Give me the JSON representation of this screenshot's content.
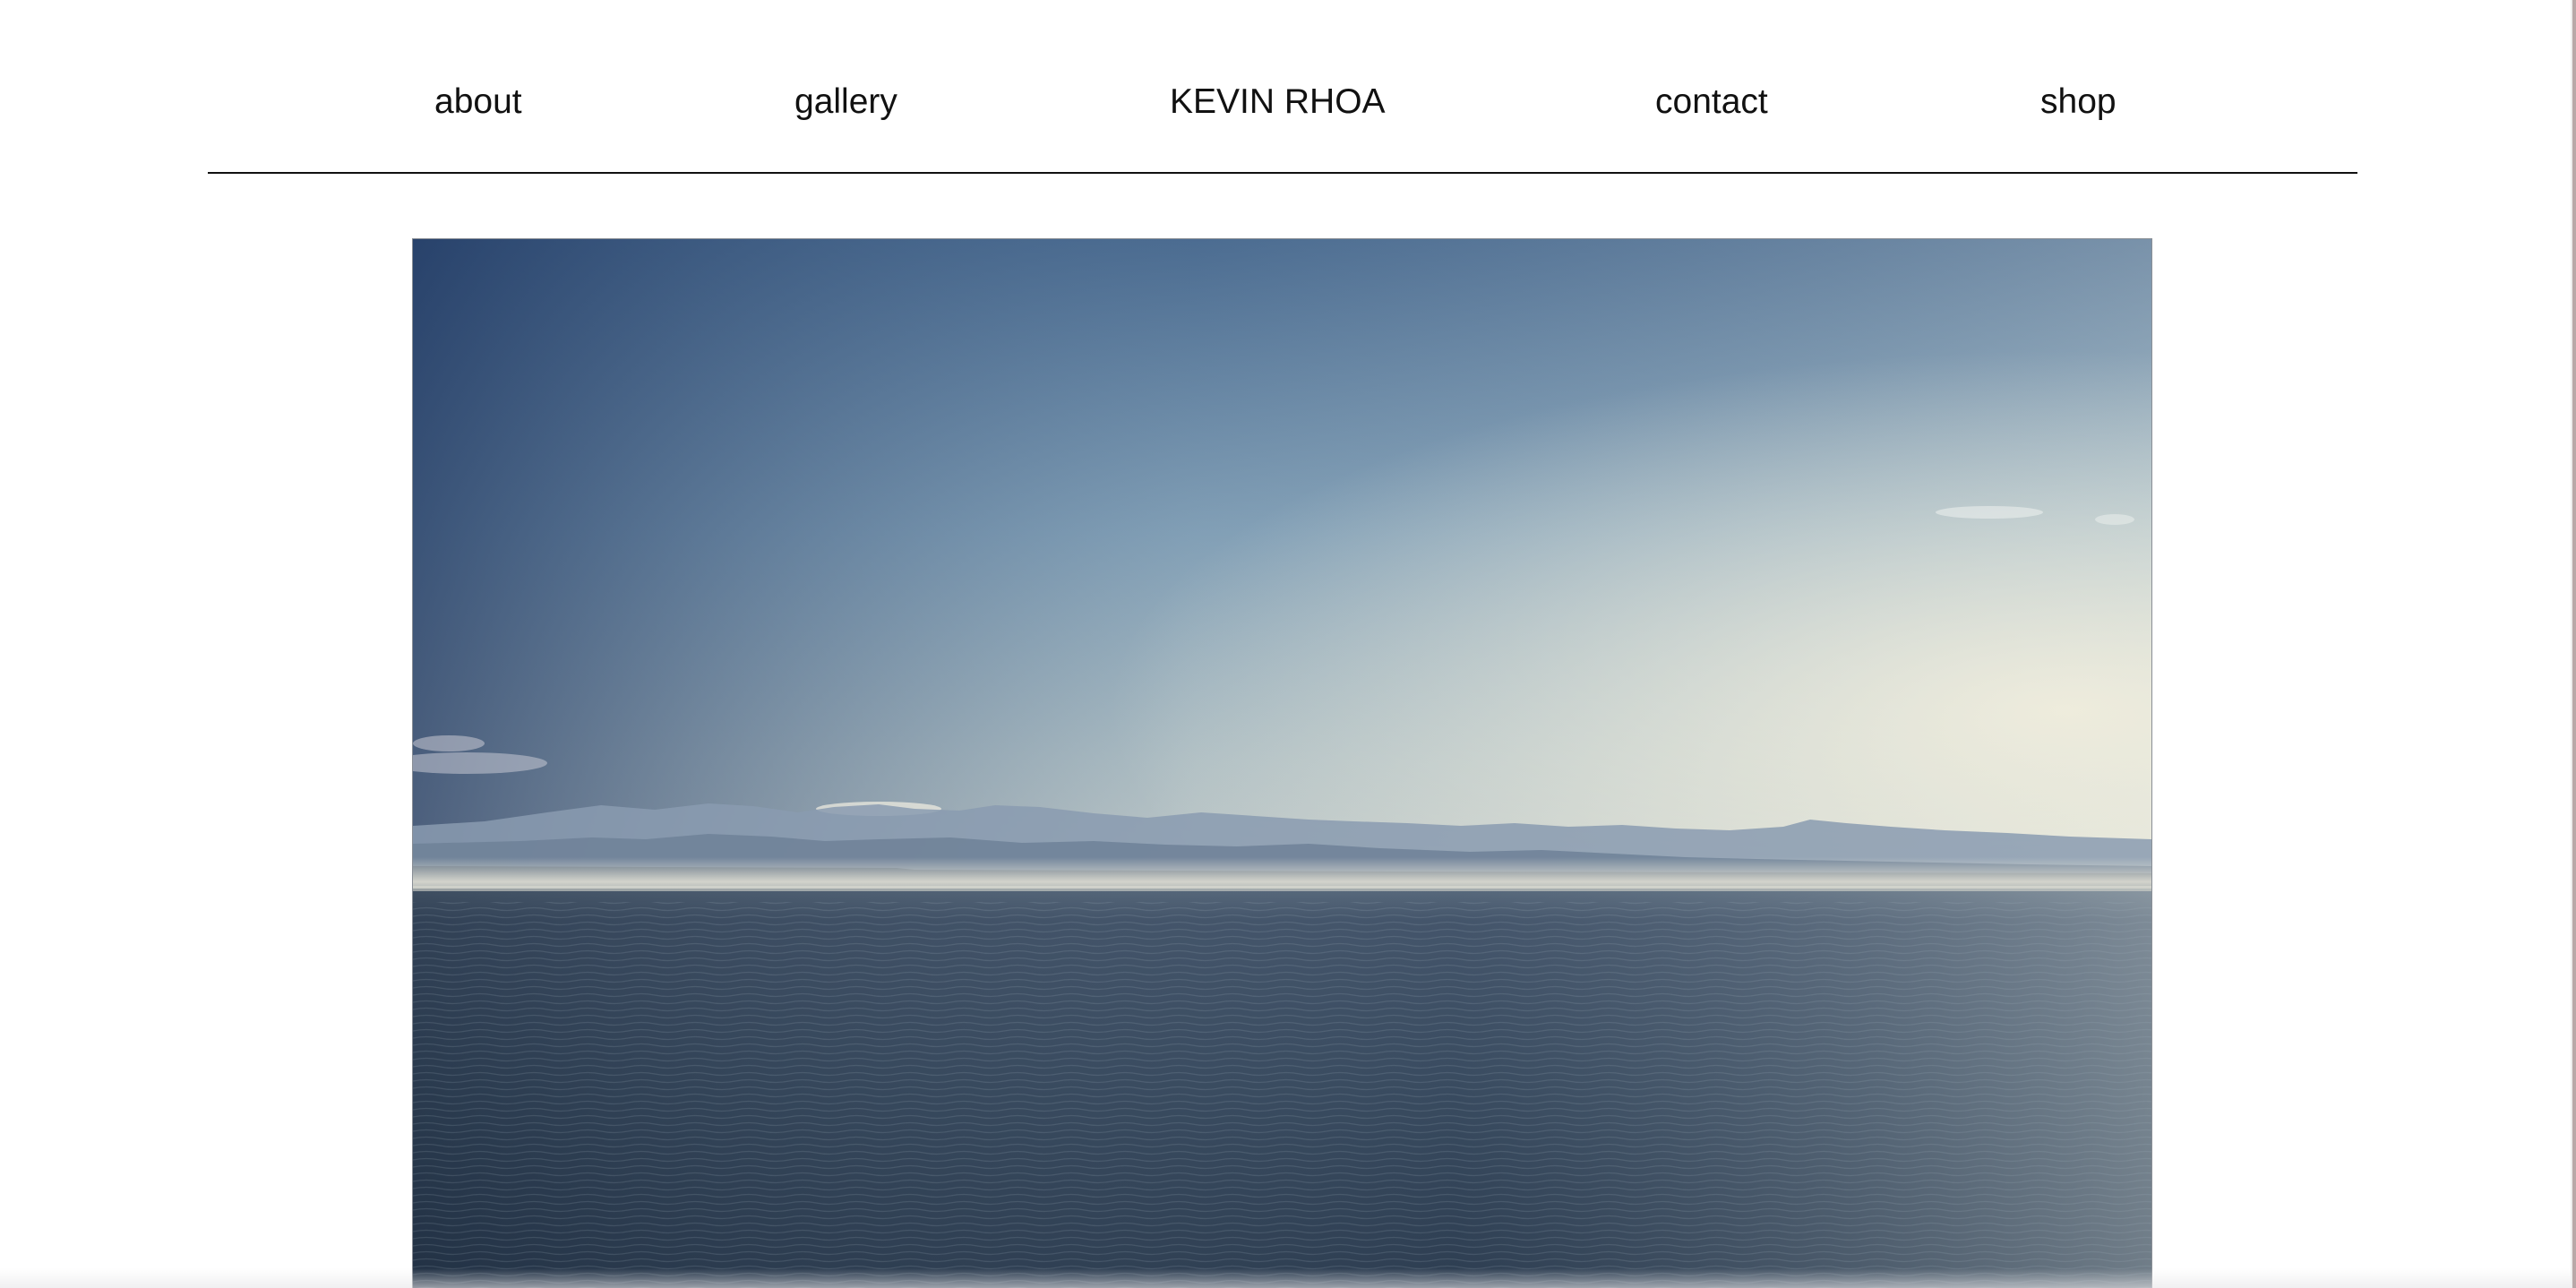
{
  "nav": {
    "about": "about",
    "gallery": "gallery",
    "brand": "KEVIN RHOA",
    "contact": "contact",
    "shop": "shop"
  },
  "hero": {
    "alt": "Calm sea with hazy mountain range under a blue sky"
  },
  "colors": {
    "background": "#ffffff",
    "text": "#111111",
    "sky_top_left": "#2c4a72",
    "sky_horizon": "#e8e6d8",
    "sea": "#2e3f54"
  }
}
